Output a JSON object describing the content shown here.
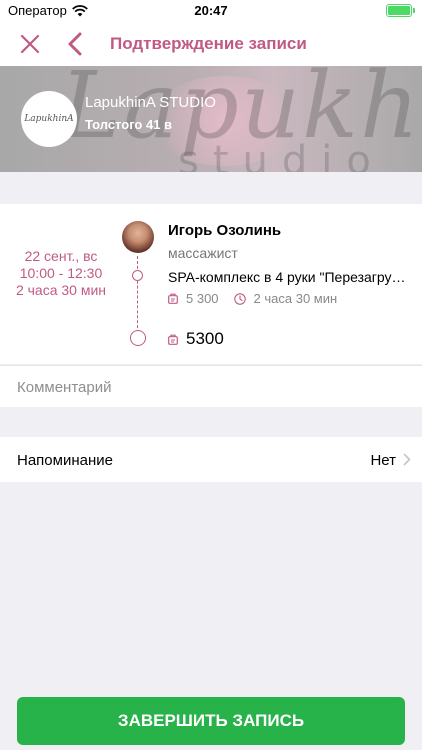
{
  "status_bar": {
    "carrier": "Оператор",
    "time": "20:47",
    "icons": [
      "wifi-icon",
      "battery-icon"
    ]
  },
  "nav": {
    "title": "Подтверждение записи",
    "icons": [
      "close-icon",
      "back-chevron-icon"
    ]
  },
  "studio": {
    "name": "LapukhinA STUDIO",
    "address": "Толстого 41 в",
    "logo_text": "LapukhinA"
  },
  "record": {
    "date": "22 сент., вс",
    "time": "10:00 - 12:30",
    "duration": "2 часа 30 мин",
    "master_name": "Игорь Озолинь",
    "master_role": "массажист",
    "service_name": "SPA-комплекс в 4 руки \"Перезагрузка\"",
    "service_price": "5 300",
    "service_duration": "2 часа 30 мин",
    "total": "5300"
  },
  "comment": {
    "placeholder": "Комментарий"
  },
  "reminder": {
    "label": "Напоминание",
    "value": "Нет"
  },
  "actions": {
    "finish": "ЗАВЕРШИТЬ ЗАПИСЬ"
  },
  "colors": {
    "accent": "#c05a85",
    "button_green": "#27b24a",
    "battery_green": "#4cd964"
  }
}
